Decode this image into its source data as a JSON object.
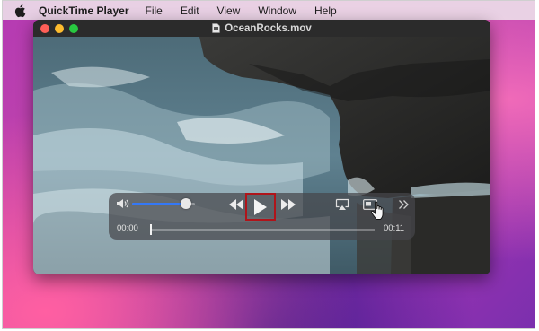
{
  "menubar": {
    "app_name": "QuickTime Player",
    "items": [
      "File",
      "Edit",
      "View",
      "Window",
      "Help"
    ]
  },
  "window": {
    "title": "OceanRocks.mov"
  },
  "player": {
    "elapsed": "00:00",
    "duration": "00:11",
    "volume_level": 0.85,
    "playback_progress": 0.0,
    "play_highlight_color": "#b0141a",
    "volume_accent": "#3478f6",
    "icons": [
      "volume-icon",
      "rewind-icon",
      "play-icon",
      "fast-forward-icon",
      "airplay-icon",
      "picture-in-picture-icon",
      "more-icon"
    ]
  }
}
